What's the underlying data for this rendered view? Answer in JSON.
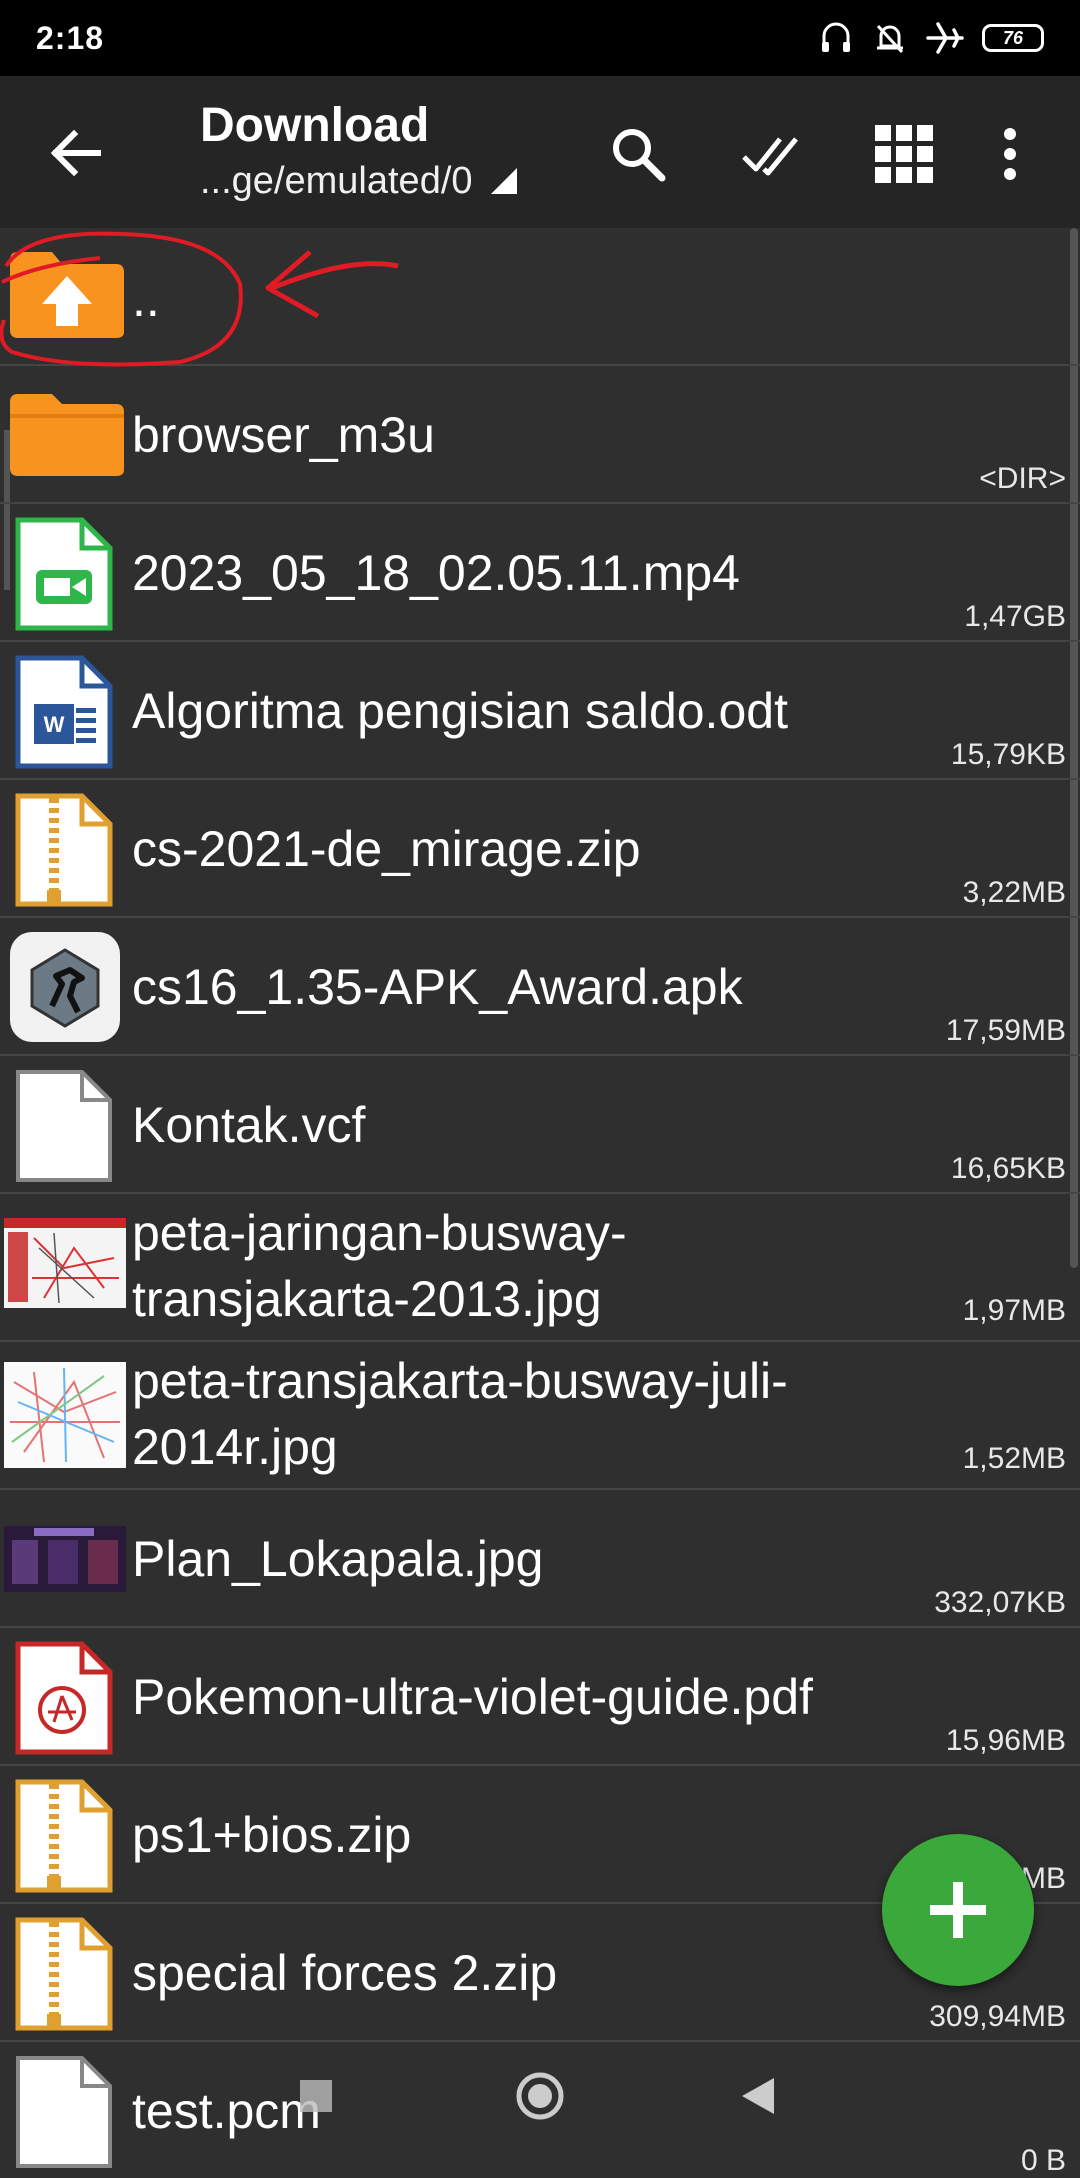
{
  "status_bar": {
    "time": "2:18",
    "battery": "76"
  },
  "app_bar": {
    "title": "Download",
    "path": "...ge/emulated/0"
  },
  "parent_entry": {
    "label": ".."
  },
  "files": [
    {
      "name": "browser_m3u",
      "size": "<DIR>",
      "icon": "folder-icon"
    },
    {
      "name": "2023_05_18_02.05.11.mp4",
      "size": "1,47GB",
      "icon": "video-file-icon"
    },
    {
      "name": "Algoritma pengisian saldo.odt",
      "size": "15,79KB",
      "icon": "word-document-icon"
    },
    {
      "name": "cs-2021-de_mirage.zip",
      "size": "3,22MB",
      "icon": "zip-file-icon"
    },
    {
      "name": "cs16_1.35-APK_Award.apk",
      "size": "17,59MB",
      "icon": "apk-app-icon"
    },
    {
      "name": "Kontak.vcf",
      "size": "16,65KB",
      "icon": "blank-file-icon"
    },
    {
      "name_lines": [
        "peta-jaringan-busway-",
        "transjakarta-2013.jpg"
      ],
      "size": "1,97MB",
      "icon": "map-image-thumbnail"
    },
    {
      "name_lines": [
        "peta-transjakarta-busway-juli-",
        "2014r.jpg"
      ],
      "size": "1,52MB",
      "icon": "map-image-thumbnail"
    },
    {
      "name": "Plan_Lokapala.jpg",
      "size": "332,07KB",
      "icon": "image-thumbnail"
    },
    {
      "name": "Pokemon-ultra-violet-guide.pdf",
      "size": "15,96MB",
      "icon": "pdf-file-icon"
    },
    {
      "name": "ps1+bios.zip",
      "size": "MB",
      "icon": "zip-file-icon"
    },
    {
      "name": "special forces 2.zip",
      "size": "309,94MB",
      "icon": "zip-file-icon"
    },
    {
      "name": "test.pcm",
      "size": "0 B",
      "icon": "blank-file-icon"
    }
  ],
  "colors": {
    "background": "#2f2f2f",
    "app_bar": "#252525",
    "fab": "#3aa83a",
    "folder": "#f7931e",
    "annotation": "#e01b24"
  }
}
